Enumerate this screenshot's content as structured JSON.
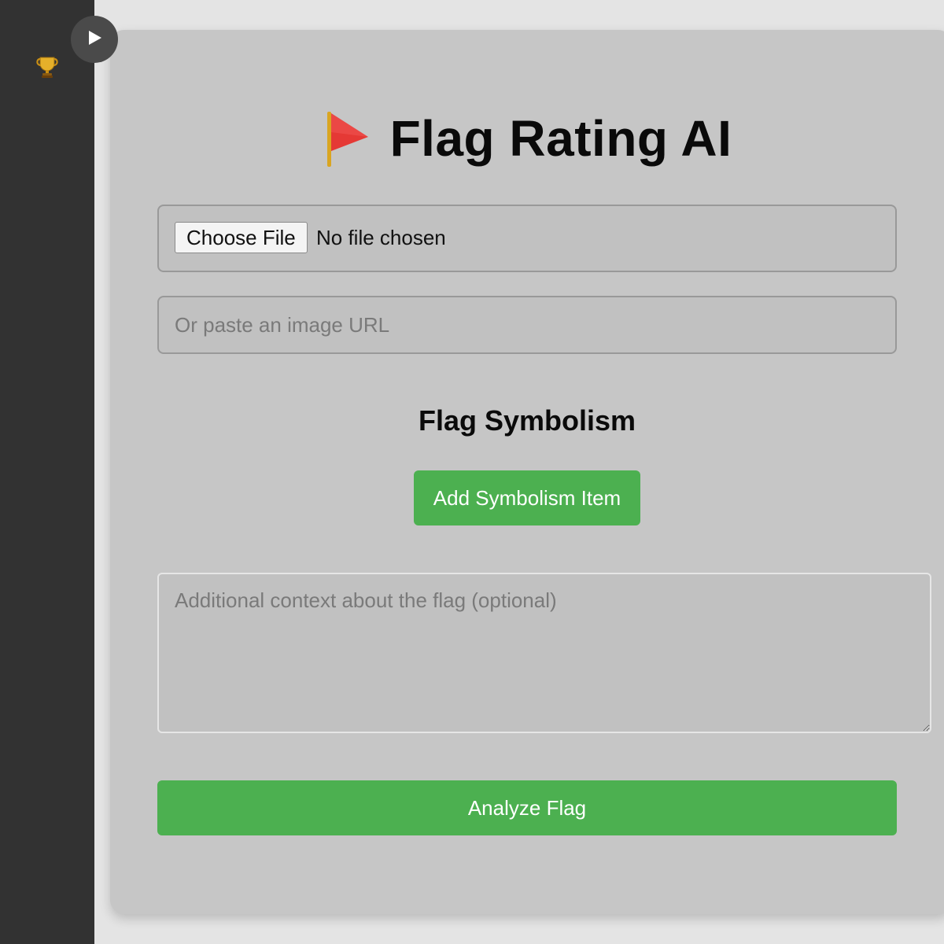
{
  "sidebar": {
    "icon": "trophy-icon",
    "toggle_icon": "play-icon"
  },
  "header": {
    "icon": "red-flag-icon",
    "title": "Flag Rating AI"
  },
  "upload": {
    "choose_file_label": "Choose File",
    "file_status": "No file chosen"
  },
  "url_input": {
    "placeholder": "Or paste an image URL",
    "value": ""
  },
  "symbolism": {
    "heading": "Flag Symbolism",
    "add_button_label": "Add Symbolism Item"
  },
  "context": {
    "placeholder": "Additional context about the flag (optional)",
    "value": ""
  },
  "actions": {
    "analyze_label": "Analyze Flag"
  },
  "colors": {
    "sidebar_bg": "#323232",
    "card_bg": "#c6c6c6",
    "accent_green": "#4cb050",
    "flag_red": "#e53935"
  }
}
